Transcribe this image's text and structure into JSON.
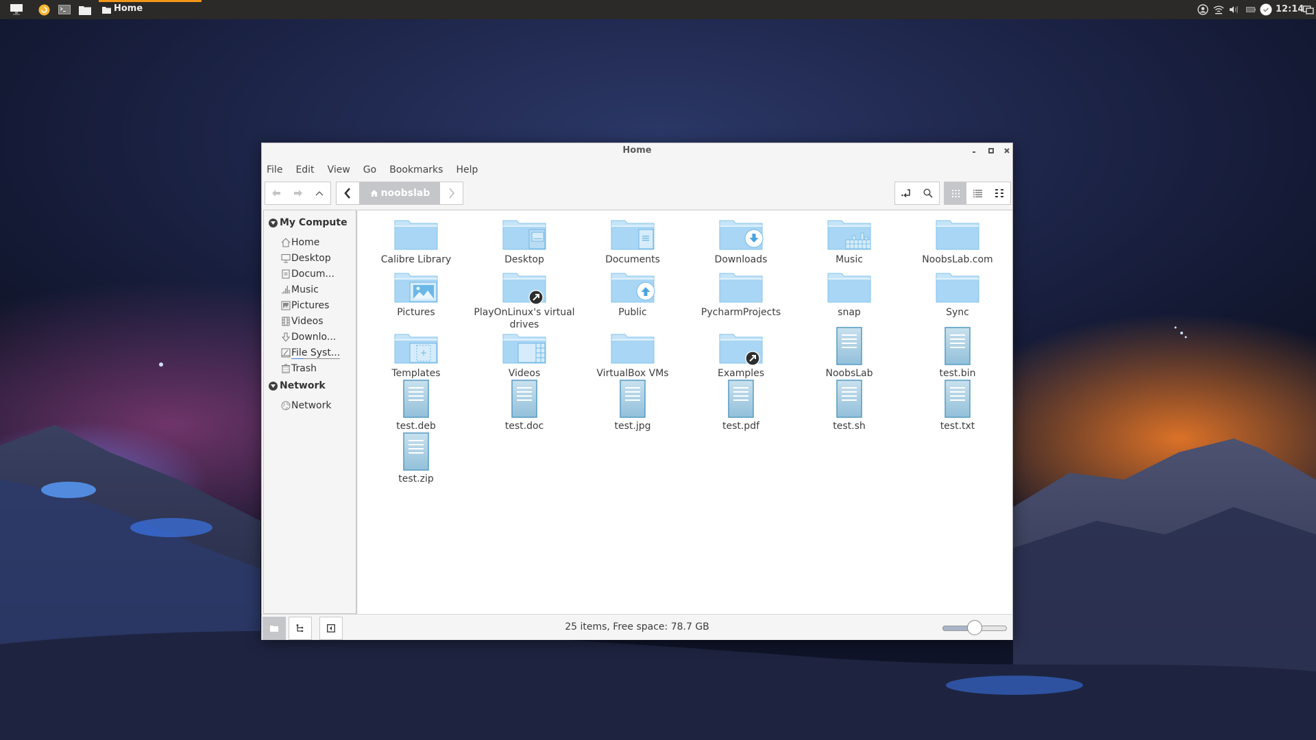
{
  "top_panel": {
    "launchers": [
      {
        "icon": "show-desktop-icon"
      },
      {
        "icon": "updater-icon"
      },
      {
        "icon": "terminal-icon"
      },
      {
        "icon": "file-manager-icon"
      }
    ],
    "task": {
      "icon": "folder-icon",
      "label": "Home"
    },
    "tray": [
      "user-icon",
      "wifi-icon",
      "volume-icon",
      "battery-icon",
      "update-check-icon"
    ],
    "clock": "12:14",
    "accent": "#f29718"
  },
  "window": {
    "title": "Home",
    "menu": [
      "File",
      "Edit",
      "View",
      "Go",
      "Bookmarks",
      "Help"
    ],
    "path": {
      "label": "noobslab"
    },
    "sidebar": {
      "sections": [
        {
          "label": "My Compute",
          "items": [
            {
              "label": "Home",
              "icon": "home-icon"
            },
            {
              "label": "Desktop",
              "icon": "desktop-icon"
            },
            {
              "label": "Docum...",
              "icon": "document-icon"
            },
            {
              "label": "Music",
              "icon": "music-icon"
            },
            {
              "label": "Pictures",
              "icon": "pictures-icon"
            },
            {
              "label": "Videos",
              "icon": "videos-icon"
            },
            {
              "label": "Downlo...",
              "icon": "download-icon"
            },
            {
              "label": "File Syst...",
              "icon": "filesystem-icon"
            },
            {
              "label": "Trash",
              "icon": "trash-icon"
            }
          ]
        },
        {
          "label": "Network",
          "items": [
            {
              "label": "Network",
              "icon": "network-icon"
            }
          ]
        }
      ]
    },
    "files": [
      {
        "name": "Calibre Library",
        "type": "folder"
      },
      {
        "name": "Desktop",
        "type": "folder-desktop"
      },
      {
        "name": "Documents",
        "type": "folder-documents"
      },
      {
        "name": "Downloads",
        "type": "folder-downloads"
      },
      {
        "name": "Music",
        "type": "folder-music"
      },
      {
        "name": "NoobsLab.com",
        "type": "folder"
      },
      {
        "name": "Pictures",
        "type": "folder-pictures"
      },
      {
        "name": "PlayOnLinux's virtual drives",
        "type": "folder-link"
      },
      {
        "name": "Public",
        "type": "folder-public"
      },
      {
        "name": "PycharmProjects",
        "type": "folder"
      },
      {
        "name": "snap",
        "type": "folder"
      },
      {
        "name": "Sync",
        "type": "folder"
      },
      {
        "name": "Templates",
        "type": "folder-templates"
      },
      {
        "name": "Videos",
        "type": "folder-videos"
      },
      {
        "name": "VirtualBox VMs",
        "type": "folder"
      },
      {
        "name": "Examples",
        "type": "folder-link"
      },
      {
        "name": "NoobsLab",
        "type": "file"
      },
      {
        "name": "test.bin",
        "type": "file"
      },
      {
        "name": "test.deb",
        "type": "file"
      },
      {
        "name": "test.doc",
        "type": "file"
      },
      {
        "name": "test.jpg",
        "type": "file"
      },
      {
        "name": "test.pdf",
        "type": "file"
      },
      {
        "name": "test.sh",
        "type": "file"
      },
      {
        "name": "test.txt",
        "type": "file"
      },
      {
        "name": "test.zip",
        "type": "file"
      }
    ],
    "status": "25 items, Free space: 78.7 GB",
    "zoom_level_fraction": 0.5,
    "active_view": "icon-view"
  }
}
